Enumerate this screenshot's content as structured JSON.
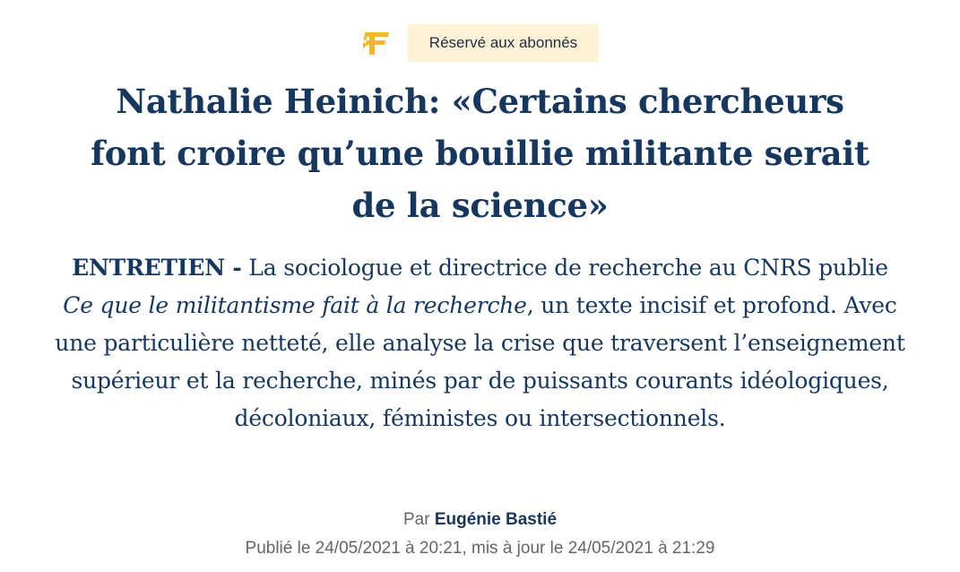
{
  "brand": {
    "logo_icon": "le-figaro-f-logo",
    "accent_color": "#f2b632"
  },
  "badge": {
    "label": "Réservé aux abonnés"
  },
  "article": {
    "headline_lines": [
      "Nathalie Heinich: «Certains chercheurs",
      "font croire qu’une bouillie militante serait",
      "de la science»"
    ],
    "kicker": "ENTRETIEN -",
    "chapo_before": " La sociologue et directrice de recherche au CNRS publie ",
    "book_title": "Ce que le militantisme fait à la recherche",
    "chapo_after": ", un texte incisif et profond. Avec une particulière netteté, elle analyse la crise que traversent l’enseignement supérieur et la recherche, minés par de puissants courants idéologiques, décoloniaux, féministes ou intersectionnels.",
    "byline_prefix": "Par ",
    "author": "Eugénie Bastié",
    "dates": "Publié le 24/05/2021 à 20:21, mis à jour le 24/05/2021 à 21:29"
  },
  "colors": {
    "headline": "#163860",
    "meta": "#666666",
    "badge_bg": "#fdf1d6"
  }
}
